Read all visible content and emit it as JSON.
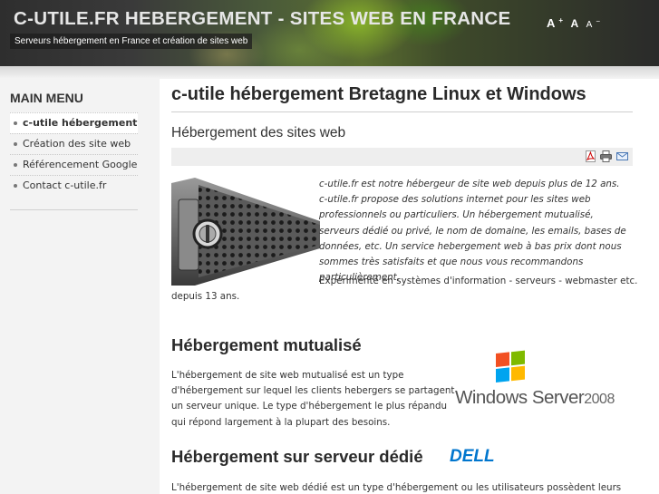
{
  "header": {
    "site_title": "C-UTILE.FR HEBERGEMENT - SITES WEB EN FRANCE",
    "tagline": "Serveurs hébergement en France et création de sites web",
    "font_sizer": {
      "increase": "A",
      "reset": "A",
      "decrease": "A"
    }
  },
  "sidebar": {
    "title": "MAIN MENU",
    "items": [
      {
        "label": "c-utile hébergement",
        "active": true
      },
      {
        "label": "Création des site web",
        "active": false
      },
      {
        "label": "Référencement Google",
        "active": false
      },
      {
        "label": "Contact c-utile.fr",
        "active": false
      }
    ]
  },
  "main": {
    "page_title": "c-utile hébergement Bretagne Linux et Windows",
    "article_title": "Hébergement des sites web",
    "toolbar": {
      "pdf": "pdf-icon",
      "print": "print-icon",
      "email": "email-icon"
    },
    "intro_text": "c-utile.fr est notre hébergeur de site web depuis plus de 12 ans. c-utile.fr propose des solutions internet pour les sites web professionnels ou particuliers. Un hébergement mutualisé, serveurs dédié ou privé, le nom de domaine, les emails, bases de données, etc. Un service hebergement web à bas prix dont nous sommes très satisfaits et que nous vous recommandons particulièrement.",
    "experience_line1": "Expérimenté en systèmes d'information - serveurs - webmaster etc.",
    "experience_line2": "depuis 13 ans.",
    "section_shared": {
      "title": "Hébergement mutualisé",
      "text": "L'hébergement de site web mutualisé est un type d'hébergement sur lequel les clients hebergers se partagent un serveur unique. Le type d'hébergement le plus répandu qui répond largement à la plupart des besoins.",
      "logo_name": "Windows Server",
      "logo_year": "2008"
    },
    "section_dedicated": {
      "title": "Hébergement sur serveur dédié",
      "logo": "DELL",
      "text": "L'hébergement de site web dédié est un type d'hébergement ou les utilisateurs possèdent leurs"
    }
  },
  "colors": {
    "header_dark": "#2e2e2e",
    "sidebar_bg": "#f3f3f3",
    "dell_blue": "#0076ce"
  }
}
